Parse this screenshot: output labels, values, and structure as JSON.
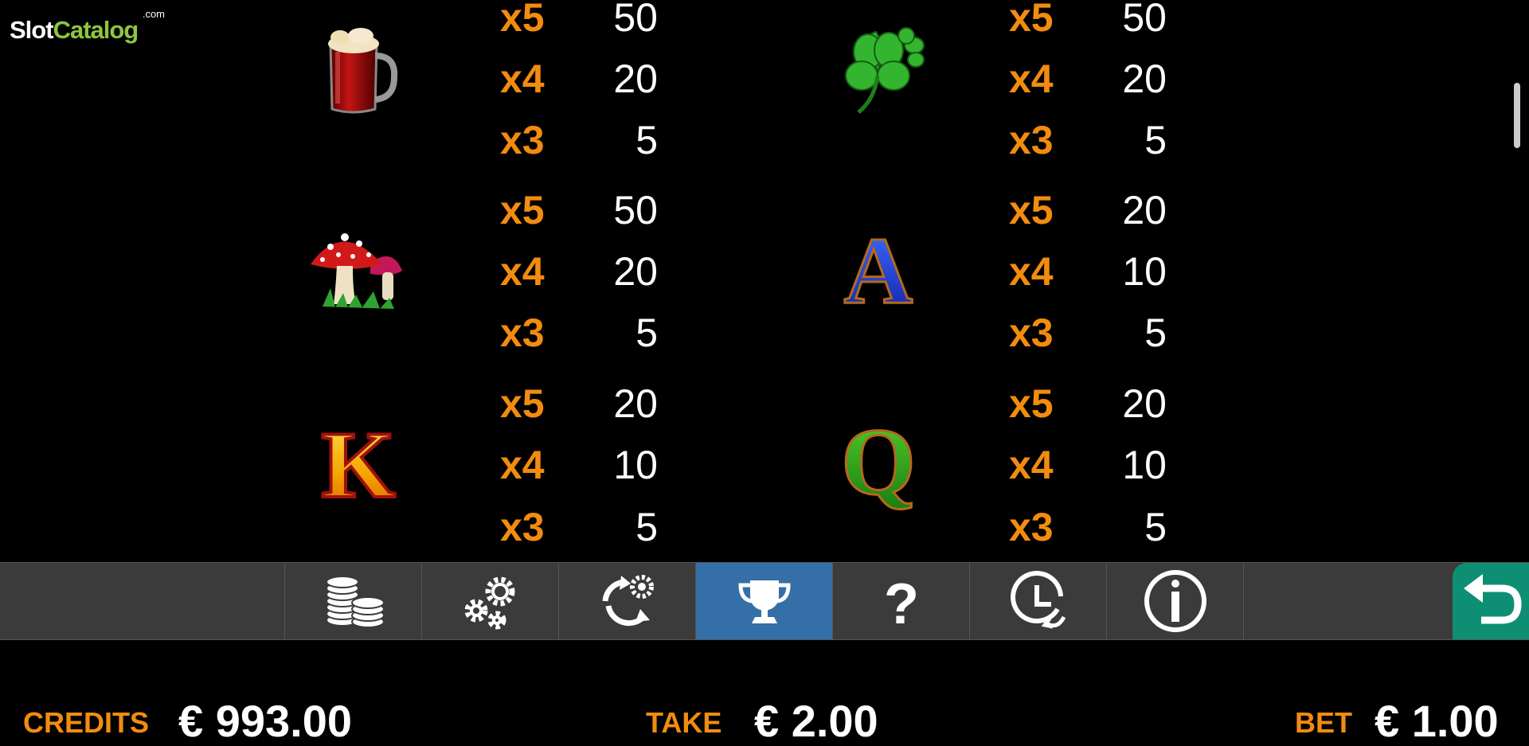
{
  "logo": {
    "text_main": "Slot",
    "text_accent": "Catalog",
    "suffix": ".com"
  },
  "paytable": {
    "left_column": [
      {
        "symbol": "beer-mug",
        "pays": [
          {
            "mult": "x5",
            "value": "50"
          },
          {
            "mult": "x4",
            "value": "20"
          },
          {
            "mult": "x3",
            "value": "5"
          }
        ]
      },
      {
        "symbol": "mushroom",
        "pays": [
          {
            "mult": "x5",
            "value": "50"
          },
          {
            "mult": "x4",
            "value": "20"
          },
          {
            "mult": "x3",
            "value": "5"
          }
        ]
      },
      {
        "symbol": "letter-k",
        "pays": [
          {
            "mult": "x5",
            "value": "20"
          },
          {
            "mult": "x4",
            "value": "10"
          },
          {
            "mult": "x3",
            "value": "5"
          }
        ]
      }
    ],
    "right_column": [
      {
        "symbol": "four-leaf-clover",
        "pays": [
          {
            "mult": "x5",
            "value": "50"
          },
          {
            "mult": "x4",
            "value": "20"
          },
          {
            "mult": "x3",
            "value": "5"
          }
        ]
      },
      {
        "symbol": "letter-a",
        "pays": [
          {
            "mult": "x5",
            "value": "20"
          },
          {
            "mult": "x4",
            "value": "10"
          },
          {
            "mult": "x3",
            "value": "5"
          }
        ]
      },
      {
        "symbol": "letter-q",
        "pays": [
          {
            "mult": "x5",
            "value": "20"
          },
          {
            "mult": "x4",
            "value": "10"
          },
          {
            "mult": "x3",
            "value": "5"
          }
        ]
      }
    ],
    "symbol_glyphs": {
      "letter-k": "K",
      "letter-a": "A",
      "letter-q": "Q"
    }
  },
  "toolbar": {
    "buttons": [
      {
        "icon": "coins-icon",
        "active": false
      },
      {
        "icon": "gears-icon",
        "active": false
      },
      {
        "icon": "autoplay-icon",
        "active": false
      },
      {
        "icon": "trophy-icon",
        "active": true
      },
      {
        "icon": "help-icon",
        "active": false
      },
      {
        "icon": "history-icon",
        "active": false
      },
      {
        "icon": "info-icon",
        "active": false
      }
    ],
    "back_icon": "back-arrow-icon"
  },
  "status": {
    "credits_label": "CREDITS",
    "credits_value": "€ 993.00",
    "take_label": "TAKE",
    "take_value": "€ 2.00",
    "bet_label": "BET",
    "bet_value": "€ 1.00"
  },
  "colors": {
    "accent_orange": "#f28c0f",
    "active_button": "#356fa7",
    "back_button": "#0e8f74",
    "logo_green": "#8dc63f",
    "toolbar": "#3b3b3b"
  }
}
